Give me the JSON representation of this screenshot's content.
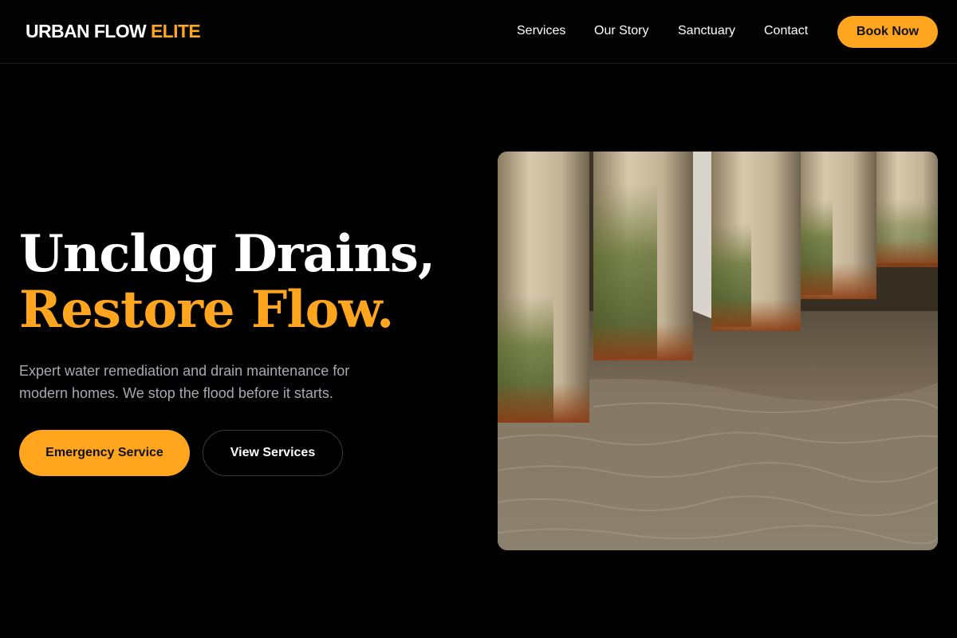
{
  "brand": {
    "name_main": "URBAN FLOW",
    "name_accent": "ELITE"
  },
  "nav": {
    "items": [
      "Services",
      "Our Story",
      "Sanctuary",
      "Contact"
    ],
    "cta_label": "Book Now"
  },
  "hero": {
    "headline_line1": "Unclog Drains,",
    "headline_line2": "Restore Flow.",
    "description": "Expert water remediation and drain maintenance for modern homes. We stop the flood before it starts.",
    "primary_button": "Emergency Service",
    "secondary_button": "View Services",
    "image_subject": "weathered wooden pilings standing in shallow water"
  },
  "colors": {
    "background": "#000000",
    "accent": "#ffa51e",
    "text": "#ffffff",
    "muted_text": "#a8a8b0"
  }
}
